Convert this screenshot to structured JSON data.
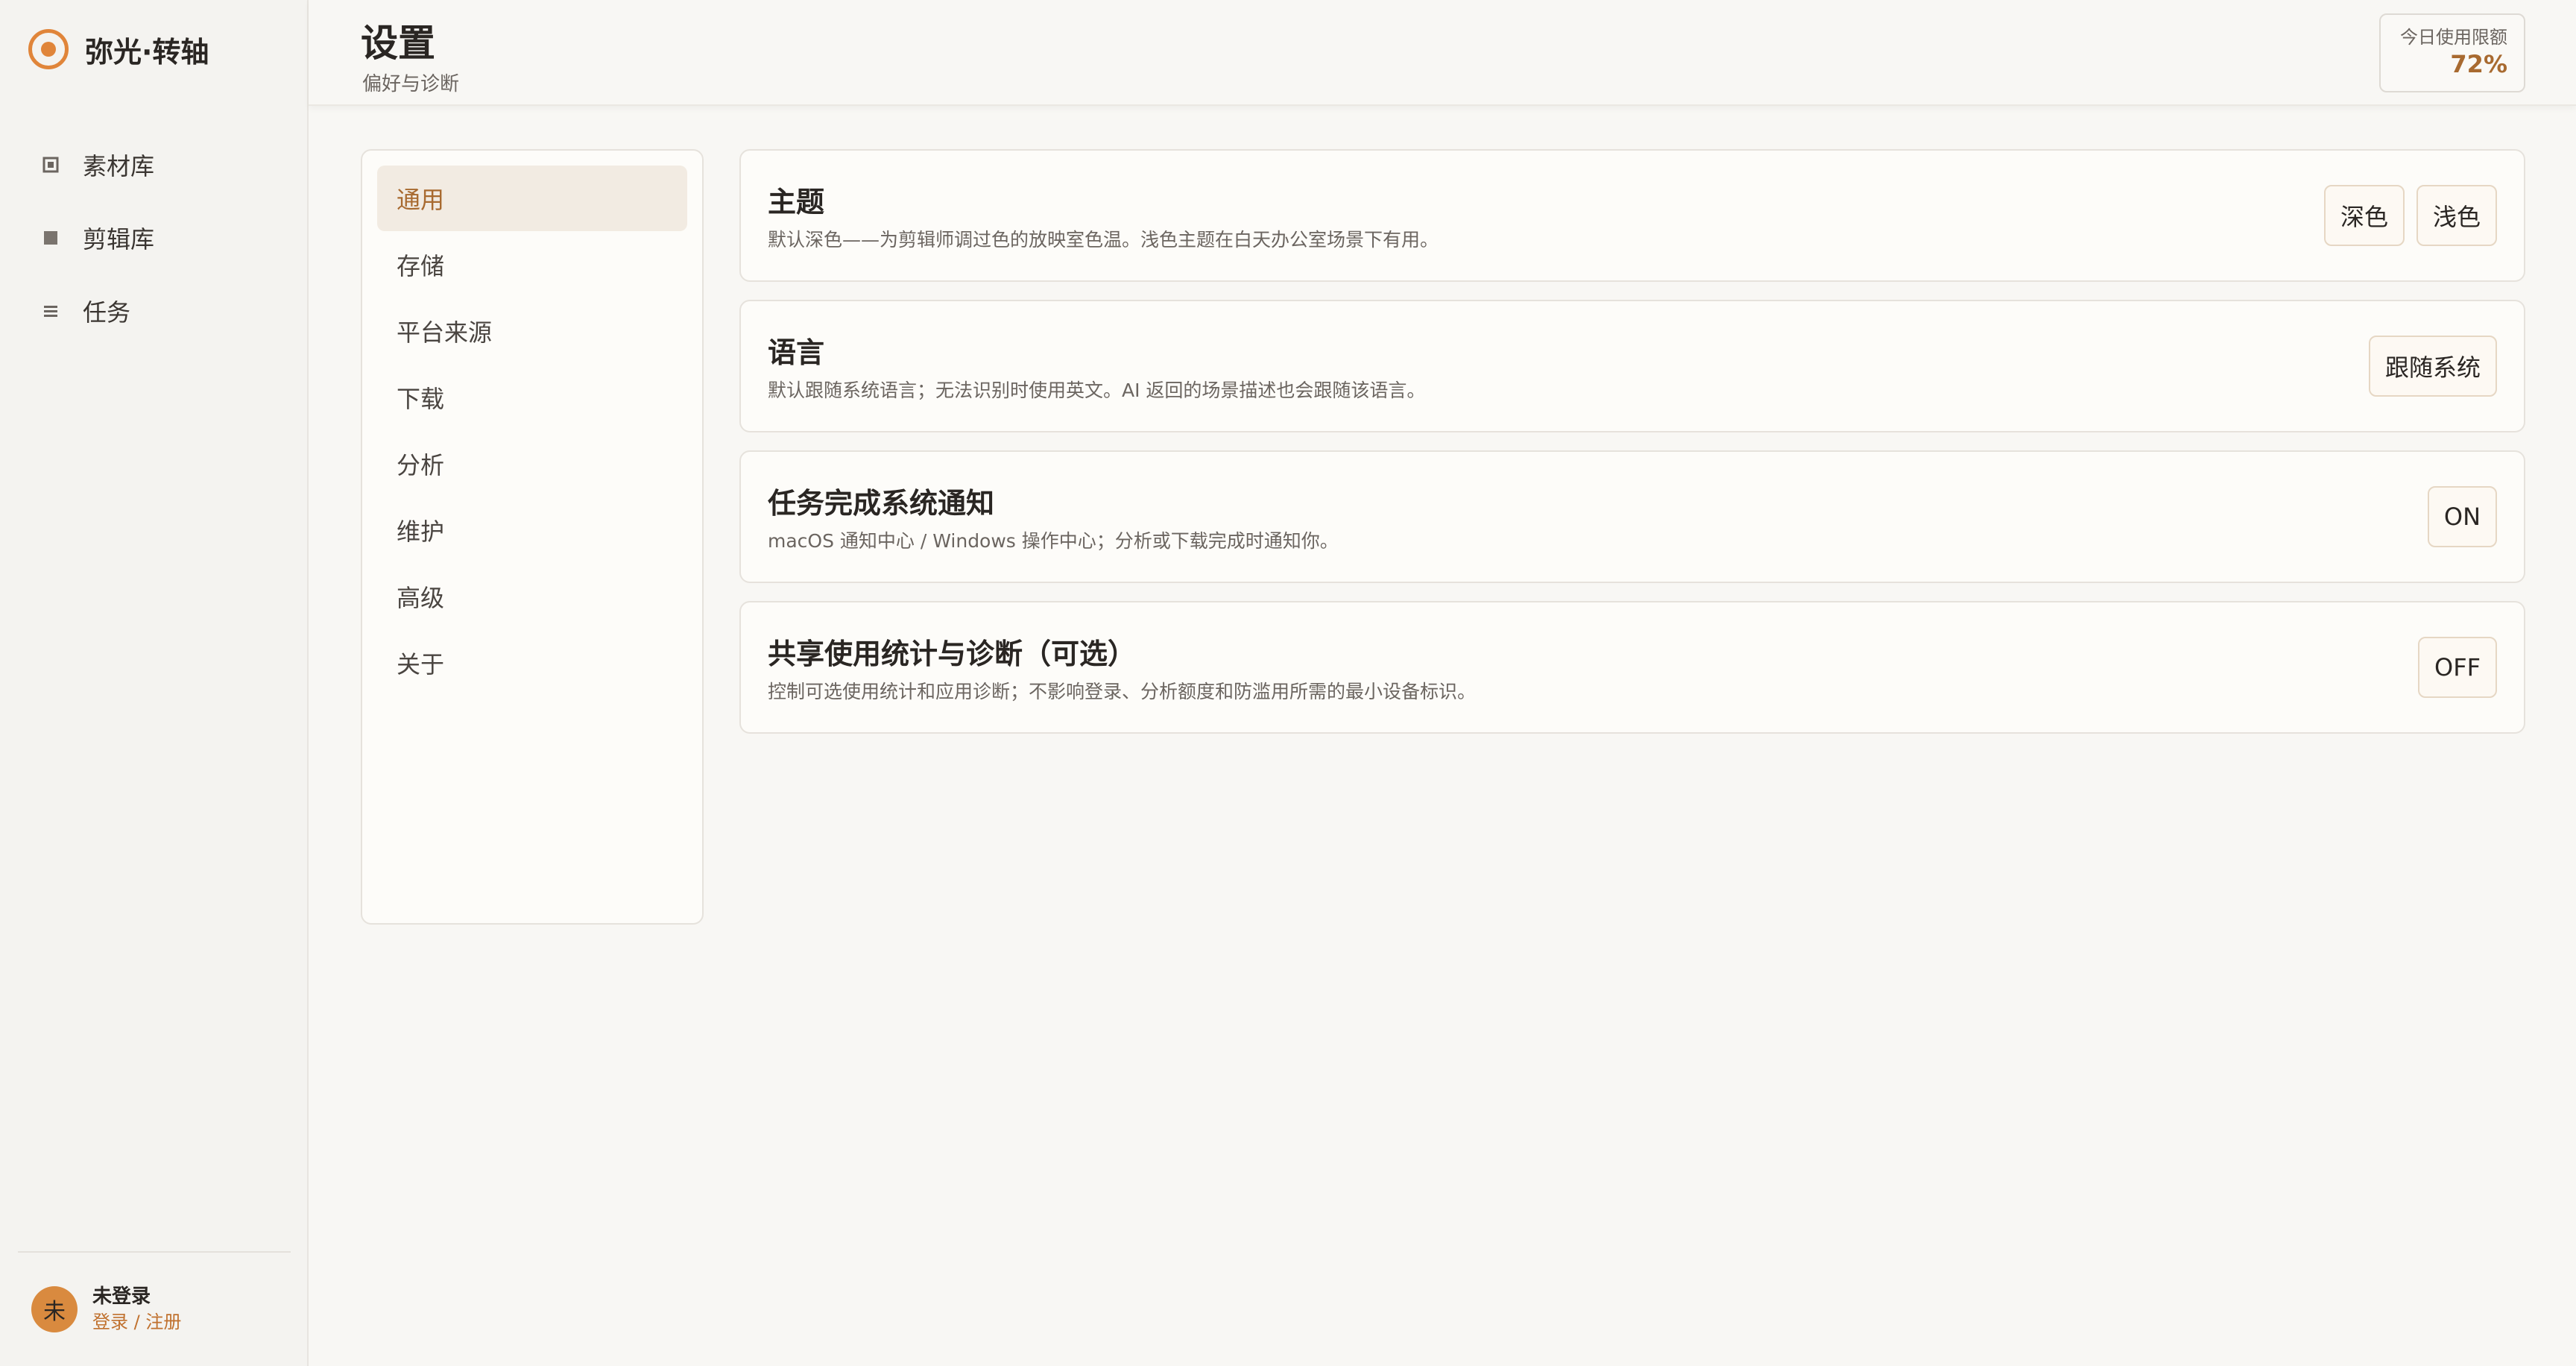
{
  "app": {
    "name": "弥光·转轴"
  },
  "sidebar": {
    "items": [
      {
        "label": "素材库",
        "icon": "square-outline-icon"
      },
      {
        "label": "剪辑库",
        "icon": "square-filled-icon"
      },
      {
        "label": "任务",
        "icon": "list-icon"
      }
    ],
    "user": {
      "avatar_text": "未",
      "name": "未登录",
      "link": "登录 / 注册"
    }
  },
  "header": {
    "title": "设置",
    "subtitle": "偏好与诊断",
    "quota": {
      "label": "今日使用限额",
      "value": "72%"
    }
  },
  "settings_nav": {
    "items": [
      {
        "label": "通用",
        "active": true
      },
      {
        "label": "存储",
        "active": false
      },
      {
        "label": "平台来源",
        "active": false
      },
      {
        "label": "下载",
        "active": false
      },
      {
        "label": "分析",
        "active": false
      },
      {
        "label": "维护",
        "active": false
      },
      {
        "label": "高级",
        "active": false
      },
      {
        "label": "关于",
        "active": false
      }
    ]
  },
  "settings": {
    "theme": {
      "title": "主题",
      "desc": "默认深色——为剪辑师调过色的放映室色温。浅色主题在白天办公室场景下有用。",
      "dark_label": "深色",
      "light_label": "浅色"
    },
    "language": {
      "title": "语言",
      "desc": "默认跟随系统语言；无法识别时使用英文。AI 返回的场景描述也会跟随该语言。",
      "value": "跟随系统"
    },
    "notify": {
      "title": "任务完成系统通知",
      "desc": "macOS 通知中心 / Windows 操作中心；分析或下载完成时通知你。",
      "value": "ON"
    },
    "telemetry": {
      "title": "共享使用统计与诊断（可选）",
      "desc": "控制可选使用统计和应用诊断；不影响登录、分析额度和防滥用所需的最小设备标识。",
      "value": "OFF"
    }
  },
  "colors": {
    "accent": "#e0853a",
    "accent_text": "#a86a30",
    "active_bg": "#f2ebe2"
  }
}
